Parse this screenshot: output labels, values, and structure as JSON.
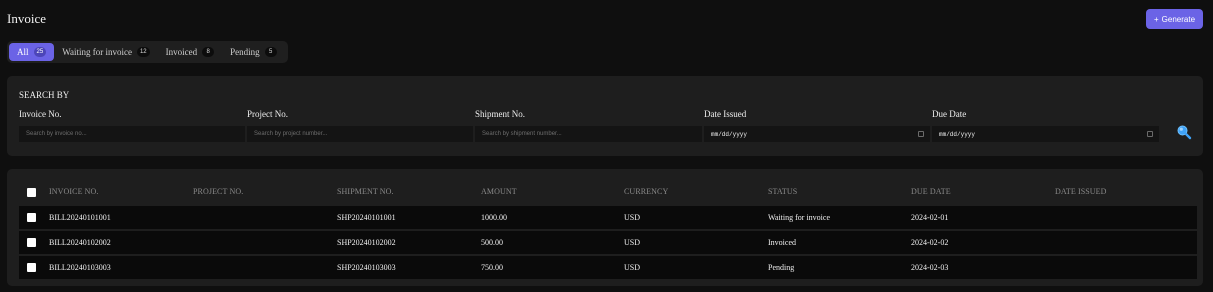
{
  "header": {
    "title": "Invoice",
    "generate_label": "Generate",
    "generate_icon": "+"
  },
  "tabs": [
    {
      "label": "All",
      "count": "25",
      "active": true
    },
    {
      "label": "Waiting for invoice",
      "count": "12",
      "active": false
    },
    {
      "label": "Invoiced",
      "count": "8",
      "active": false
    },
    {
      "label": "Pending",
      "count": "5",
      "active": false
    }
  ],
  "search": {
    "heading": "SEARCH BY",
    "fields": [
      {
        "label": "Invoice No.",
        "placeholder": "Search by invoice no..."
      },
      {
        "label": "Project No.",
        "placeholder": "Search by project number..."
      },
      {
        "label": "Shipment No.",
        "placeholder": "Search by shipment number..."
      },
      {
        "label": "Date Issued",
        "value": "mm/dd/yyyy"
      },
      {
        "label": "Due Date",
        "value": "mm/dd/yyyy"
      }
    ],
    "search_icon": "magnifier"
  },
  "table": {
    "columns": [
      "INVOICE NO.",
      "PROJECT NO.",
      "SHIPMENT NO.",
      "AMOUNT",
      "CURRENCY",
      "STATUS",
      "DUE DATE",
      "DATE ISSUED"
    ],
    "rows": [
      {
        "invoice_no": "BILL20240101001",
        "project_no": "",
        "shipment_no": "SHP20240101001",
        "amount": "1000.00",
        "currency": "USD",
        "status": "Waiting for invoice",
        "due_date": "2024-02-01",
        "date_issued": ""
      },
      {
        "invoice_no": "BILL20240102002",
        "project_no": "",
        "shipment_no": "SHP20240102002",
        "amount": "500.00",
        "currency": "USD",
        "status": "Invoiced",
        "due_date": "2024-02-02",
        "date_issued": ""
      },
      {
        "invoice_no": "BILL20240103003",
        "project_no": "",
        "shipment_no": "SHP20240103003",
        "amount": "750.00",
        "currency": "USD",
        "status": "Pending",
        "due_date": "2024-02-03",
        "date_issued": ""
      }
    ]
  },
  "colors": {
    "accent": "#6b63e6",
    "background": "#0f0f0f",
    "panel": "#1e1e1e",
    "search_icon": "#3fa2f7"
  }
}
